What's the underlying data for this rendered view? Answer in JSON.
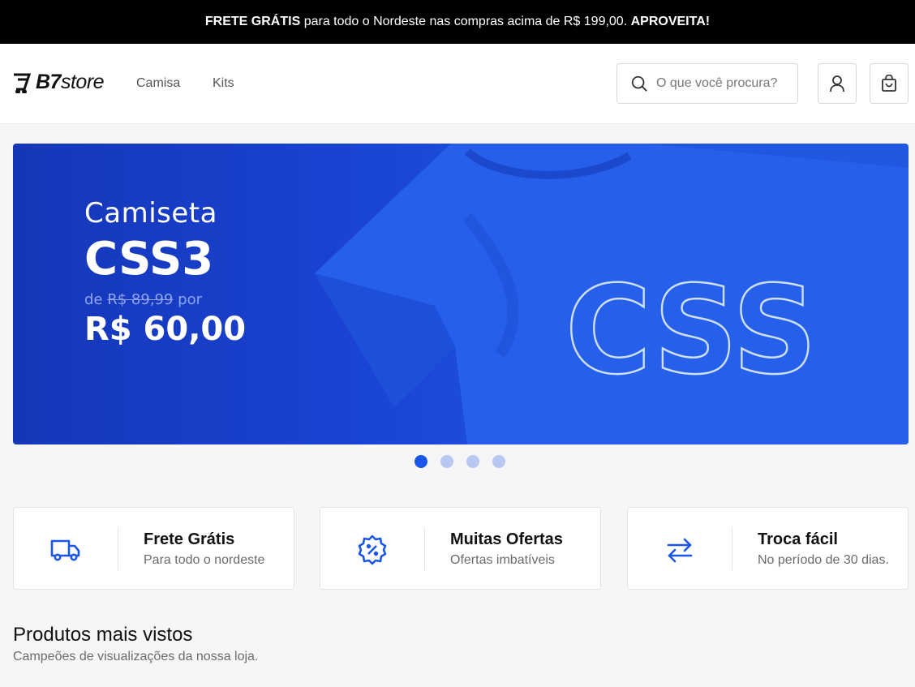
{
  "announcement": {
    "bold_lead": "FRETE GRÁTIS",
    "text": " para todo o Nordeste nas compras acima de R$ 199,00. ",
    "bold_tail": "APROVEITA!"
  },
  "header": {
    "logo_bold": "B7",
    "logo_rest": "store",
    "nav": [
      {
        "label": "Camisa"
      },
      {
        "label": "Kits"
      }
    ],
    "search_placeholder": "O que você procura?"
  },
  "banner": {
    "line1": "Camiseta",
    "line2": "CSS3",
    "old_price_prefix": "de ",
    "old_price": "R$ 89,99",
    "old_price_suffix": " por",
    "new_price": "R$ 60,00",
    "shirt_print": "CSS",
    "colors": {
      "background": "#1a44d4",
      "shirt": "#2a5ee8"
    }
  },
  "carousel": {
    "count": 4,
    "active_index": 0
  },
  "features": [
    {
      "icon": "truck-icon",
      "title": "Frete Grátis",
      "subtitle": "Para todo o nordeste"
    },
    {
      "icon": "discount-badge-icon",
      "title": "Muitas Ofertas",
      "subtitle": "Ofertas imbatíveis"
    },
    {
      "icon": "swap-arrows-icon",
      "title": "Troca fácil",
      "subtitle": "No período de 30 dias."
    }
  ],
  "section": {
    "title": "Produtos mais vistos",
    "subtitle": "Campeões de visualizações da nossa loja."
  },
  "colors": {
    "accent": "#1a56e8",
    "topbar": "#000000"
  }
}
